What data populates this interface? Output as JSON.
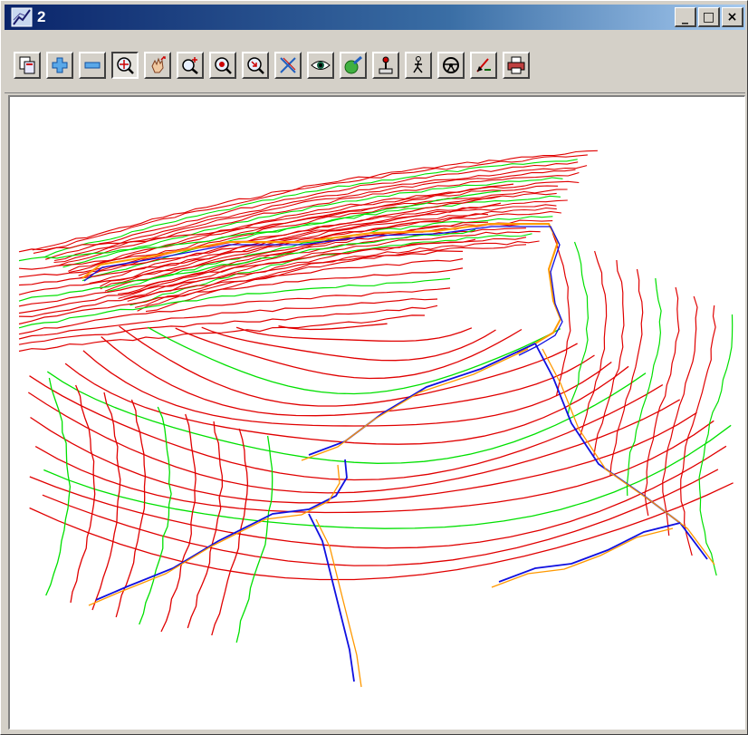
{
  "window": {
    "title": "2",
    "title_icon": "line-drawing-icon",
    "controls": {
      "minimize_glyph": "_",
      "maximize_glyph": "□",
      "close_glyph": "×"
    }
  },
  "toolbar": {
    "tools": [
      {
        "name": "copy-view-button",
        "icon": "copy-icon"
      },
      {
        "name": "zoom-in-plus-button",
        "icon": "plus-icon"
      },
      {
        "name": "zoom-out-minus-button",
        "icon": "minus-icon"
      },
      {
        "name": "zoom-window-button",
        "icon": "zoom-window-icon",
        "active": true
      },
      {
        "name": "pan-button",
        "icon": "hand-icon"
      },
      {
        "name": "zoom-plus-button",
        "icon": "magnify-plus-icon"
      },
      {
        "name": "zoom-fit-button",
        "icon": "magnify-target-icon"
      },
      {
        "name": "zoom-previous-button",
        "icon": "magnify-arrow-icon"
      },
      {
        "name": "clip-button",
        "icon": "cross-lines-icon"
      },
      {
        "name": "view-eye-button",
        "icon": "eye-icon"
      },
      {
        "name": "render-button",
        "icon": "globe-pen-icon"
      },
      {
        "name": "joystick-button",
        "icon": "joystick-icon"
      },
      {
        "name": "walk-button",
        "icon": "walker-icon"
      },
      {
        "name": "drive-button",
        "icon": "steering-wheel-icon"
      },
      {
        "name": "fly-button",
        "icon": "pen-arrow-icon"
      },
      {
        "name": "plot-button",
        "icon": "printer-icon"
      }
    ]
  },
  "colors": {
    "contour_major": "#00e000",
    "contour_minor": "#e00000",
    "drainage": "#1010e0",
    "catchment": "#ff9900",
    "titlebar_start": "#0a246a",
    "titlebar_end": "#a6caf0"
  }
}
